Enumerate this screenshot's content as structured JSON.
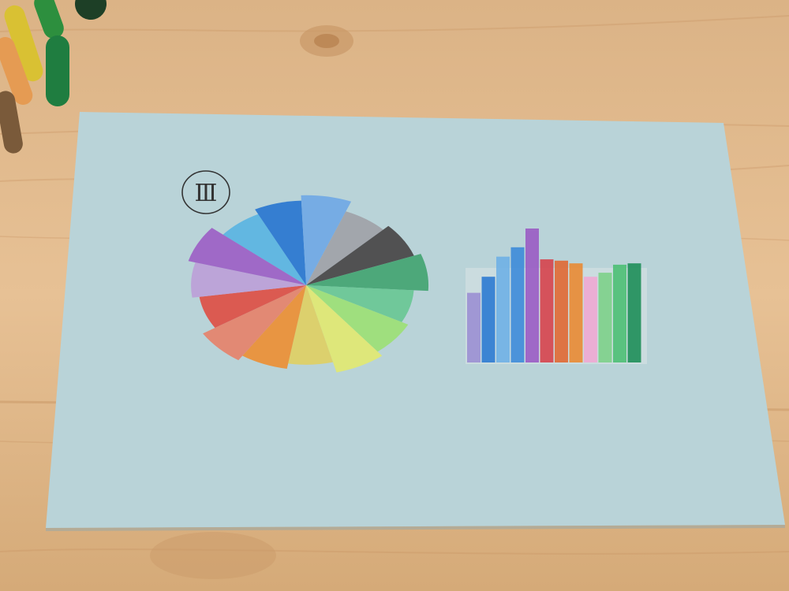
{
  "page": {
    "label": "Ⅲ"
  },
  "colors": {
    "table_wood": "#e2b888",
    "paper": "#b9d3d8",
    "wheel_segments": [
      "#52b2e3",
      "#1d6ed0",
      "#6aa5e6",
      "#9e9ea5",
      "#3e3a3b",
      "#39a06a",
      "#63c68f",
      "#9ae06f",
      "#e4ea6a",
      "#e2cf5b",
      "#f08a28",
      "#e97b63",
      "#e04439",
      "#bc9bd8",
      "#9a56c4"
    ],
    "bars": [
      "#9b8fd3",
      "#2c7ad1",
      "#6fb0e5",
      "#3d8bd9",
      "#9a5bc4",
      "#d6424d",
      "#e06833",
      "#e98a33",
      "#eea8d3",
      "#7dd08a",
      "#4cbf74",
      "#1e8e59"
    ],
    "crayons": [
      "#d9c133",
      "#2d8f3e",
      "#e59b53",
      "#1f7d40",
      "#7a5a3a",
      "#1d3f26"
    ]
  },
  "chart_data": [
    {
      "type": "pie",
      "title": "",
      "colors": [
        "#52b2e3",
        "#1d6ed0",
        "#6aa5e6",
        "#9e9ea5",
        "#3e3a3b",
        "#39a06a",
        "#63c68f",
        "#9ae06f",
        "#e4ea6a",
        "#e2cf5b",
        "#f08a28",
        "#e97b63",
        "#e04439",
        "#bc9bd8",
        "#9a56c4"
      ],
      "values": [
        1,
        1,
        1,
        1,
        1,
        1,
        1,
        1,
        1,
        1,
        1,
        1,
        1,
        1,
        1
      ]
    },
    {
      "type": "bar",
      "title": "",
      "values": [
        0.52,
        0.64,
        0.79,
        0.86,
        1.0,
        0.77,
        0.76,
        0.74,
        0.64,
        0.67,
        0.73,
        0.74
      ]
    }
  ]
}
